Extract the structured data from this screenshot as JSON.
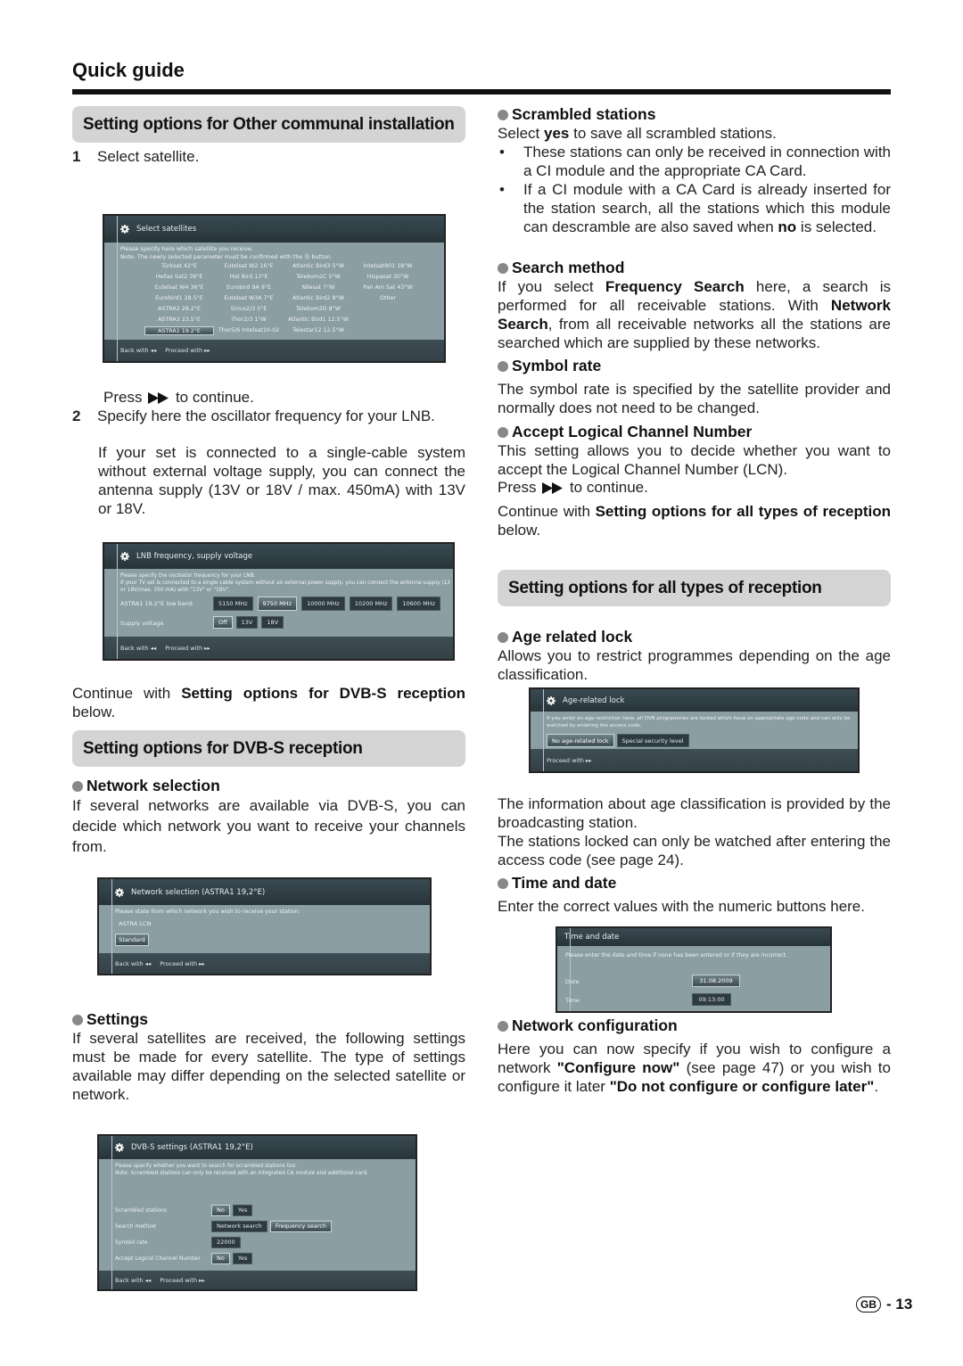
{
  "page": {
    "title": "Quick guide",
    "page_badge": "GB",
    "page_number": "- 13"
  },
  "left": {
    "sec_other": "Setting options for Other communal installation",
    "step1_num": "1",
    "step1_text": "Select satellite.",
    "press1_a": "Press",
    "press1_b": "to continue.",
    "step2_num": "2",
    "step2_text": "Specify here the oscillator frequency for your LNB.",
    "step2_note": "If your set is connected to a single-cable system without external voltage supply, you can connect the antenna  supply (13V or 18V / max. 450mA) with 13V or 18V.",
    "continue_a": "Continue with",
    "continue_b": "Setting options for DVB-S reception",
    "continue_c": "below.",
    "sec_dvbs": "Setting options for DVB-S reception",
    "network_sel_head": "Network selection",
    "network_sel_text": "If several networks are available via DVB-S, you can decide which network you want to receive your channels from.",
    "settings_head": "Settings",
    "settings_text": "If several satellites are received, the following settings must be made for every satellite. The type of settings available may differ depending on the selected satellite or network."
  },
  "right": {
    "scrambled_head": "Scrambled stations",
    "scrambled_a": "Select",
    "scrambled_b": "yes",
    "scrambled_c": "to save all scrambled stations.",
    "scrambled_bullet1": "These stations can only be received in connection with a CI module and the appropriate CA Card.",
    "scrambled_bullet2_a": "If a CI module with a CA Card is already inserted for the station search, all the stations which this module can descramble are also saved when",
    "scrambled_bullet2_b": "no",
    "scrambled_bullet2_c": "is selected.",
    "search_head": "Search method",
    "search_a": "If you select",
    "search_b": "Frequency Search",
    "search_c": "here, a search is performed for all receivable stations. With",
    "search_d": "Network Search",
    "search_e": ", from all receivable networks all the stations are searched which are supplied by these networks.",
    "symbol_head": "Symbol rate",
    "symbol_text": "The symbol rate is specified by the satellite provider and normally does not need to be changed.",
    "lcn_head": "Accept Logical Channel Number",
    "lcn_text": "This setting allows you to decide whether you want to accept the Logical Channel Number (LCN).",
    "press_a": "Press",
    "press_b": "to continue.",
    "cont_a": "Continue with",
    "cont_b": "Setting options for all types of reception",
    "cont_c": "below.",
    "sec_all": "Setting options for all types of reception",
    "age_head": "Age related lock",
    "age_text": "Allows you to restrict programmes depending on the age classification.",
    "age_info": "The information about age classification is provided by the broadcasting station.",
    "age_info2": "The stations locked can only be watched after entering the access code (see page 24).",
    "time_head": "Time and date",
    "time_text": "Enter the correct values with the numeric buttons here.",
    "netconf_head": "Network configuration",
    "netconf_a": "Here you can now specify if you wish to configure a network",
    "netconf_b": "\"Configure now\"",
    "netconf_c": "(see page 47) or you wish to configure it later",
    "netconf_d": "\"Do not configure or configure later\"",
    "netconf_e": "."
  },
  "screens": {
    "sat": {
      "title": "Select satellites",
      "note1": "Please specify here which satellite you receive.",
      "note2": "Note: The newly selected parameter must be confirmed with the Ⓞ button.",
      "satellites": [
        "Türksat 42°E",
        "Eutelsat W2 16°E",
        "Atlantic Bird3 5°W",
        "Intelsat901 18°W",
        "Hellas Sat2 39°E",
        "Hot Bird 13°E",
        "Telekom2C 5°W",
        "Hispasat 30°W",
        "Eutelsat W4 36°E",
        "Eurobird 9A 9°E",
        "Nilesat 7°W",
        "Pan Am Sat 43°W",
        "Eurobird1 28.5°E",
        "Eutelsat W3A 7°E",
        "Atlantic Bird2 8°W",
        "Other",
        "ASTRA2 28.2°E",
        "Sirius2/3 5°E",
        "Telekom2D 8°W",
        "",
        "ASTRA3 23.5°E",
        "Thor2/3 1°W",
        "Atlantic Bird1 12.5°W",
        "",
        "ASTRA1 19.2°E",
        "Thor5/6 Intelsat10-02",
        "Telestar12 12.5°W",
        ""
      ],
      "selected": "ASTRA1 19.2°E",
      "back": "Back with ◂◂",
      "proceed": "Proceed with ▸▸"
    },
    "lnb": {
      "title": "LNB frequency, supply voltage",
      "note1": "Please specify the oscillator frequency for your LNB.",
      "note2": "If your TV set is connected to a single cable system without an external power supply, you can connect the antenna supply (13 or 18V/max. 350 mA) with \"13V\" or \"18V\".",
      "band_label": "ASTRA1 19.2°E low band",
      "frequencies": [
        "5150 MHz",
        "9750 MHz",
        "10000 MHz",
        "10200 MHz",
        "10600 MHz"
      ],
      "selected_frequency": "9750 MHz",
      "voltage_label": "Supply voltage",
      "voltages": [
        "Off",
        "13V",
        "18V"
      ],
      "selected_voltage": "Off",
      "back": "Back with ◂◂",
      "proceed": "Proceed with ▸▸"
    },
    "network": {
      "title": "Network selection (ASTRA1 19,2°E)",
      "note": "Please state from which network you wish to receive your station.",
      "network_name": "ASTRA LCN",
      "option": "Standard",
      "back": "Back with ◂◂",
      "proceed": "Proceed with ▸▸"
    },
    "dvbs": {
      "title": "DVB-S settings (ASTRA1 19,2°E)",
      "note1": "Please specify whether you want to search for scrambled stations too.",
      "note2": "Note: Scrambled stations can only be received with an integrated CA module and additional card.",
      "rows": [
        {
          "label": "Scrambled stations",
          "options": [
            "No",
            "Yes"
          ],
          "selected": "No"
        },
        {
          "label": "Search method",
          "options": [
            "Network search",
            "Frequency search"
          ],
          "selected": "Frequency search"
        },
        {
          "label": "Symbol rate",
          "options": [
            "22000"
          ],
          "selected": ""
        },
        {
          "label": "Accept Logical Channel Number",
          "options": [
            "No",
            "Yes"
          ],
          "selected": "No"
        }
      ],
      "back": "Back with ◂◂",
      "proceed": "Proceed with ▸▸"
    },
    "age": {
      "title": "Age-related lock",
      "note": "If you enter an age restriction here, all DVB programmes are locked which have an appropriate age code and can only be watched by entering the access code.",
      "options": [
        "No age-related lock",
        "Special security level"
      ],
      "selected": "No age-related lock",
      "proceed": "Proceed with ▸▸"
    },
    "time": {
      "title": "Time and date",
      "note": "Please enter the date and time if none has been entered or if they are incorrect.",
      "date_label": "Date",
      "date_value": "31.08.2009",
      "time_label": "Time",
      "time_value": "09:13:00"
    }
  }
}
